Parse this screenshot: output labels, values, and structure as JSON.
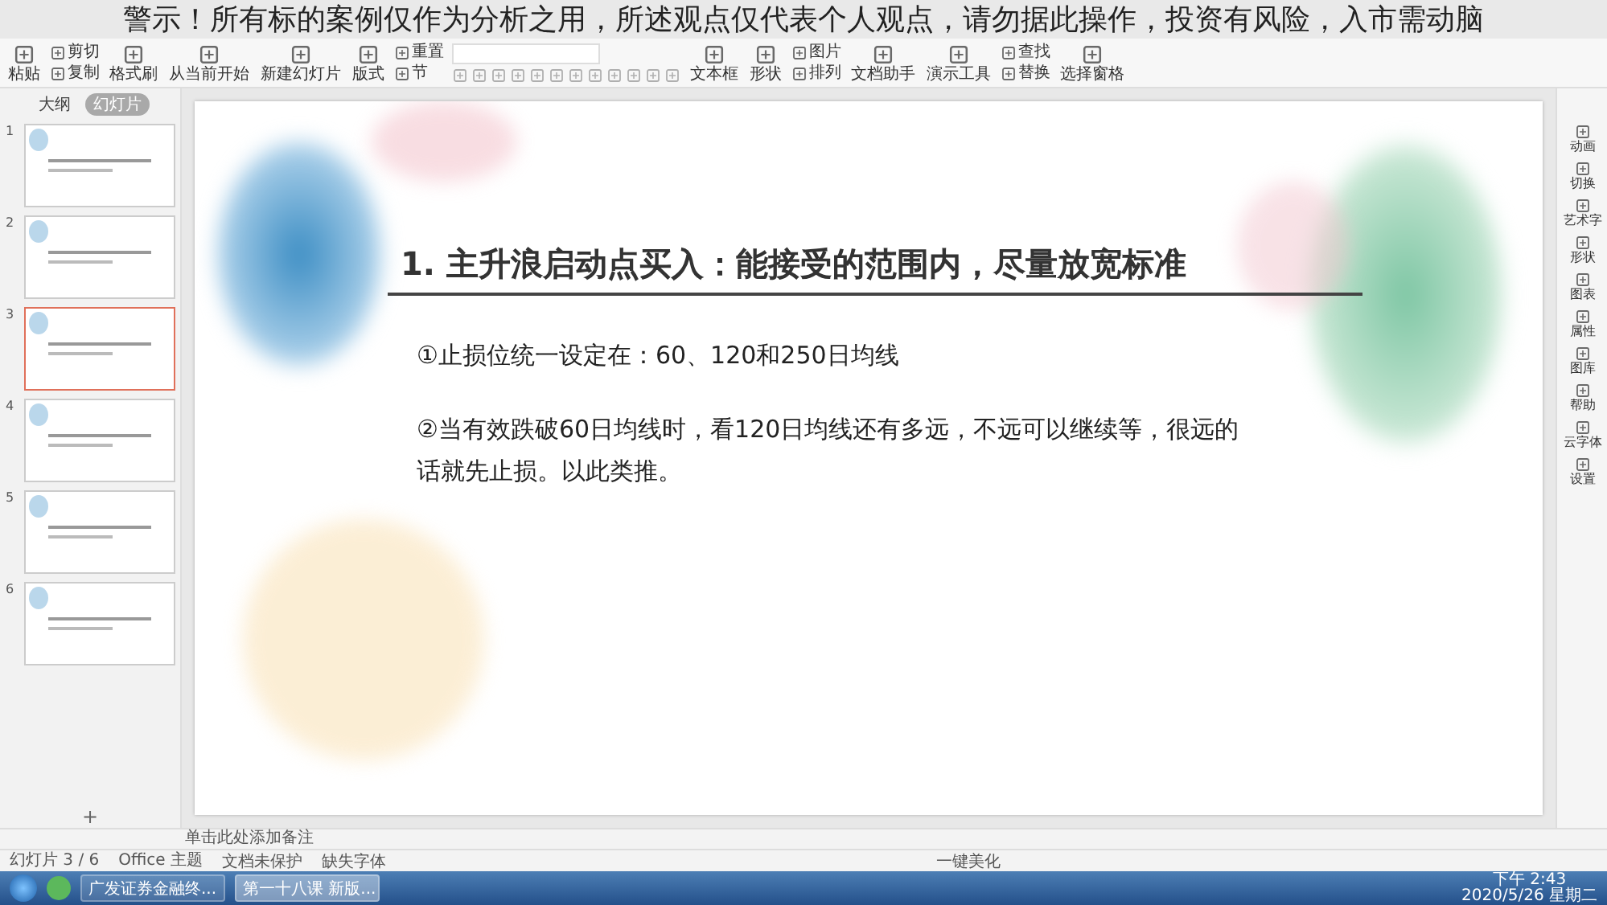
{
  "overlay_caption": "警示！所有标的案例仅作为分析之用，所述观点仅代表个人观点，请勿据此操作，投资有风险，入市需动脑",
  "ribbon": [
    {
      "kind": "large",
      "label": "粘贴"
    },
    {
      "kind": "pair",
      "labels": [
        "剪切",
        "复制"
      ]
    },
    {
      "kind": "large",
      "label": "格式刷"
    },
    {
      "kind": "large",
      "label": "从当前开始"
    },
    {
      "kind": "large",
      "label": "新建幻灯片"
    },
    {
      "kind": "large",
      "label": "版式"
    },
    {
      "kind": "pair",
      "labels": [
        "重置",
        "节"
      ]
    },
    {
      "kind": "format"
    },
    {
      "kind": "large",
      "label": "文本框"
    },
    {
      "kind": "large",
      "label": "形状"
    },
    {
      "kind": "pair",
      "labels": [
        "图片",
        "排列"
      ]
    },
    {
      "kind": "large",
      "label": "文档助手"
    },
    {
      "kind": "large",
      "label": "演示工具"
    },
    {
      "kind": "pair",
      "labels": [
        "查找",
        "替换"
      ]
    },
    {
      "kind": "large",
      "label": "选择窗格"
    }
  ],
  "panel_tabs": [
    {
      "label": "大纲",
      "selected": false
    },
    {
      "label": "幻灯片",
      "selected": true
    }
  ],
  "thumbnails": [
    {
      "number": "1",
      "selected": false
    },
    {
      "number": "2",
      "selected": false
    },
    {
      "number": "3",
      "selected": true
    },
    {
      "number": "4",
      "selected": false
    },
    {
      "number": "5",
      "selected": false
    },
    {
      "number": "6",
      "selected": false
    }
  ],
  "slide": {
    "title": "1. 主升浪启动点买入：能接受的范围内，尽量放宽标准",
    "paragraphs": [
      "①止损位统一设定在：60、120和250日均线",
      "②当有效跌破60日均线时，看120日均线还有多远，不远可以继续等，很远的话就先止损。以此类推。"
    ]
  },
  "add_slide_button": "+",
  "right_sidebar": [
    "动画",
    "切换",
    "艺术字",
    "形状",
    "图表",
    "属性",
    "图库",
    "帮助",
    "云字体",
    "设置"
  ],
  "notes_placeholder": "单击此处添加备注",
  "status_bar": {
    "slide_count": "幻灯片 3 / 6",
    "theme": "Office 主题",
    "protection": "文档未保护",
    "fonts": "缺失字体",
    "beautify": "一键美化"
  },
  "taskbar": {
    "items": [
      {
        "label": "广发证券金融终...",
        "selected": false
      },
      {
        "label": "第一十八课 新版...",
        "selected": true
      }
    ],
    "time": "下午 2:43",
    "date": "2020/5/26 星期二"
  }
}
